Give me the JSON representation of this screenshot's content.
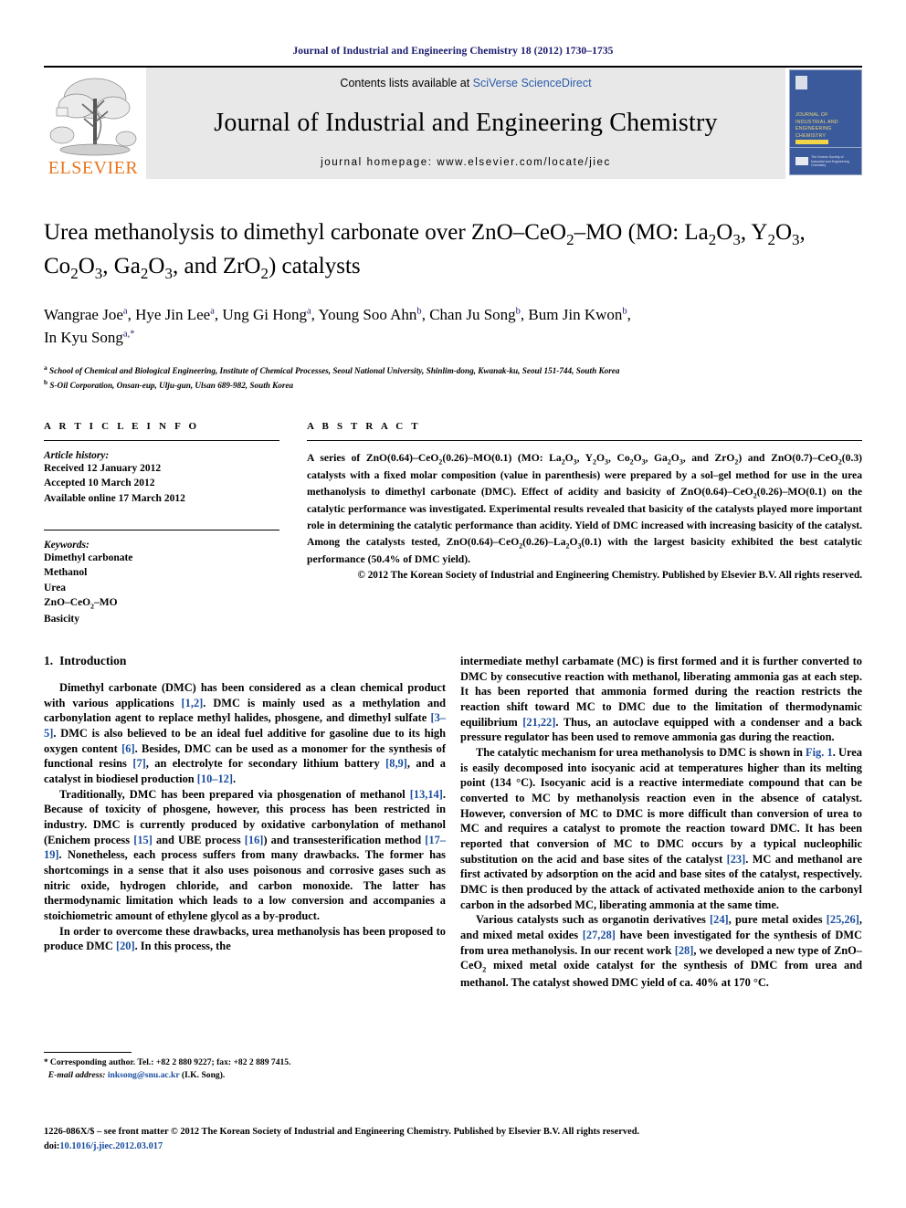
{
  "running_head": "Journal of Industrial and Engineering Chemistry 18 (2012) 1730–1735",
  "masthead": {
    "publisher_logo_text": "ELSEVIER",
    "contents_prefix": "Contents lists available at ",
    "contents_link": "SciVerse ScienceDirect",
    "journal_name": "Journal of Industrial and Engineering Chemistry",
    "homepage": "journal homepage: www.elsevier.com/locate/jiec",
    "cover_title": "Journal of Industrial and Engineering Chemistry",
    "cover_footer": "The Korean Society of Industrial and Engineering Chemistry"
  },
  "title": {
    "line1_a": "Urea methanolysis to dimethyl carbonate over ZnO–CeO",
    "line1_sub1": "2",
    "line1_b": "–MO (MO: La",
    "line1_sub2": "2",
    "line1_c": "O",
    "line1_sub3": "3",
    "line1_d": ", Y",
    "line1_sub4": "2",
    "line1_e": "O",
    "line1_sub5": "3",
    "line1_f": ",",
    "line2_a": "Co",
    "line2_sub1": "2",
    "line2_b": "O",
    "line2_sub2": "3",
    "line2_c": ", Ga",
    "line2_sub3": "2",
    "line2_d": "O",
    "line2_sub4": "3",
    "line2_e": ", and ZrO",
    "line2_sub5": "2",
    "line2_f": ") catalysts"
  },
  "authors": [
    {
      "name": "Wangrae Joe",
      "mark": "a",
      "sep": ", "
    },
    {
      "name": "Hye Jin Lee",
      "mark": "a",
      "sep": ", "
    },
    {
      "name": "Ung Gi Hong",
      "mark": "a",
      "sep": ", "
    },
    {
      "name": "Young Soo Ahn",
      "mark": "b",
      "sep": ", "
    },
    {
      "name": "Chan Ju Song",
      "mark": "b",
      "sep": ", "
    },
    {
      "name": "Bum Jin Kwon",
      "mark": "b",
      "sep": ","
    },
    {
      "name": "In Kyu Song",
      "mark": "a,*",
      "sep": ""
    }
  ],
  "affiliations": [
    {
      "mark": "a",
      "text": "School of Chemical and Biological Engineering, Institute of Chemical Processes, Seoul National University, Shinlim-dong, Kwanak-ku, Seoul 151-744, South Korea"
    },
    {
      "mark": "b",
      "text": "S-Oil Corporation, Onsan-eup, Ulju-gun, Ulsan 689-982, South Korea"
    }
  ],
  "article_info": {
    "heading": "A R T I C L E    I N F O",
    "history_label": "Article history:",
    "history": [
      "Received 12 January 2012",
      "Accepted 10 March 2012",
      "Available online 17 March 2012"
    ],
    "keywords_label": "Keywords:",
    "keywords": [
      "Dimethyl carbonate",
      "Methanol",
      "Urea",
      "ZnO–CeO2–MO",
      "Basicity"
    ]
  },
  "abstract": {
    "heading": "A B S T R A C T",
    "text": "A series of ZnO(0.64)–CeO2(0.26)–MO(0.1) (MO: La2O3, Y2O3, Co2O3, Ga2O3, and ZrO2) and ZnO(0.7)–CeO2(0.3) catalysts with a fixed molar composition (value in parenthesis) were prepared by a sol–gel method for use in the urea methanolysis to dimethyl carbonate (DMC). Effect of acidity and basicity of ZnO(0.64)–CeO2(0.26)–MO(0.1) on the catalytic performance was investigated. Experimental results revealed that basicity of the catalysts played more important role in determining the catalytic performance than acidity. Yield of DMC increased with increasing basicity of the catalyst. Among the catalysts tested, ZnO(0.64)–CeO2(0.26)–La2O3(0.1) with the largest basicity exhibited the best catalytic performance (50.4% of DMC yield).",
    "copyright": "© 2012 The Korean Society of Industrial and Engineering Chemistry. Published by Elsevier B.V. All rights reserved."
  },
  "body": {
    "section_number": "1.",
    "section_title": "Introduction",
    "left_paragraphs": [
      "Dimethyl carbonate (DMC) has been considered as a clean chemical product with various applications [1,2]. DMC is mainly used as a methylation and carbonylation agent to replace methyl halides, phosgene, and dimethyl sulfate [3–5]. DMC is also believed to be an ideal fuel additive for gasoline due to its high oxygen content [6]. Besides, DMC can be used as a monomer for the synthesis of functional resins [7], an electrolyte for secondary lithium battery [8,9], and a catalyst in biodiesel production [10–12].",
      "Traditionally, DMC has been prepared via phosgenation of methanol [13,14]. Because of toxicity of phosgene, however, this process has been restricted in industry. DMC is currently produced by oxidative carbonylation of methanol (Enichem process [15] and UBE process [16]) and transesterification method [17–19]. Nonetheless, each process suffers from many drawbacks. The former has shortcomings in a sense that it also uses poisonous and corrosive gases such as nitric oxide, hydrogen chloride, and carbon monoxide. The latter has thermodynamic limitation which leads to a low conversion and accompanies a stoichiometric amount of ethylene glycol as a by-product.",
      "In order to overcome these drawbacks, urea methanolysis has been proposed to produce DMC [20]. In this process, the"
    ],
    "right_paragraphs": [
      "intermediate methyl carbamate (MC) is first formed and it is further converted to DMC by consecutive reaction with methanol, liberating ammonia gas at each step. It has been reported that ammonia formed during the reaction restricts the reaction shift toward MC to DMC due to the limitation of thermodynamic equilibrium [21,22]. Thus, an autoclave equipped with a condenser and a back pressure regulator has been used to remove ammonia gas during the reaction.",
      "The catalytic mechanism for urea methanolysis to DMC is shown in Fig. 1. Urea is easily decomposed into isocyanic acid at temperatures higher than its melting point (134 °C). Isocyanic acid is a reactive intermediate compound that can be converted to MC by methanolysis reaction even in the absence of catalyst. However, conversion of MC to DMC is more difficult than conversion of urea to MC and requires a catalyst to promote the reaction toward DMC. It has been reported that conversion of MC to DMC occurs by a typical nucleophilic substitution on the acid and base sites of the catalyst [23]. MC and methanol are first activated by adsorption on the acid and base sites of the catalyst, respectively. DMC is then produced by the attack of activated methoxide anion to the carbonyl carbon in the adsorbed MC, liberating ammonia at the same time.",
      "Various catalysts such as organotin derivatives [24], pure metal oxides [25,26], and mixed metal oxides [27,28] have been investigated for the synthesis of DMC from urea methanolysis. In our recent work [28], we developed a new type of ZnO–CeO2 mixed metal oxide catalyst for the synthesis of DMC from urea and methanol. The catalyst showed DMC yield of ca. 40% at 170 °C."
    ]
  },
  "footnote": {
    "star": "*",
    "corresponding": "Corresponding author. Tel.: +82 2 880 9227; fax: +82 2 889 7415.",
    "email_label": "E-mail address:",
    "email": "inksong@snu.ac.kr",
    "email_suffix": "(I.K. Song)."
  },
  "bottom": {
    "line1": "1226-086X/$ – see front matter © 2012 The Korean Society of Industrial and Engineering Chemistry. Published by Elsevier B.V. All rights reserved.",
    "doi_label": "doi:",
    "doi": "10.1016/j.jiec.2012.03.017"
  },
  "colors": {
    "running_head": "#1a1a6e",
    "link": "#1a4d9e",
    "elsevier_orange": "#E87722",
    "sciencedirect_blue": "#2a5caa",
    "cover_blue": "#3a5a9b"
  }
}
